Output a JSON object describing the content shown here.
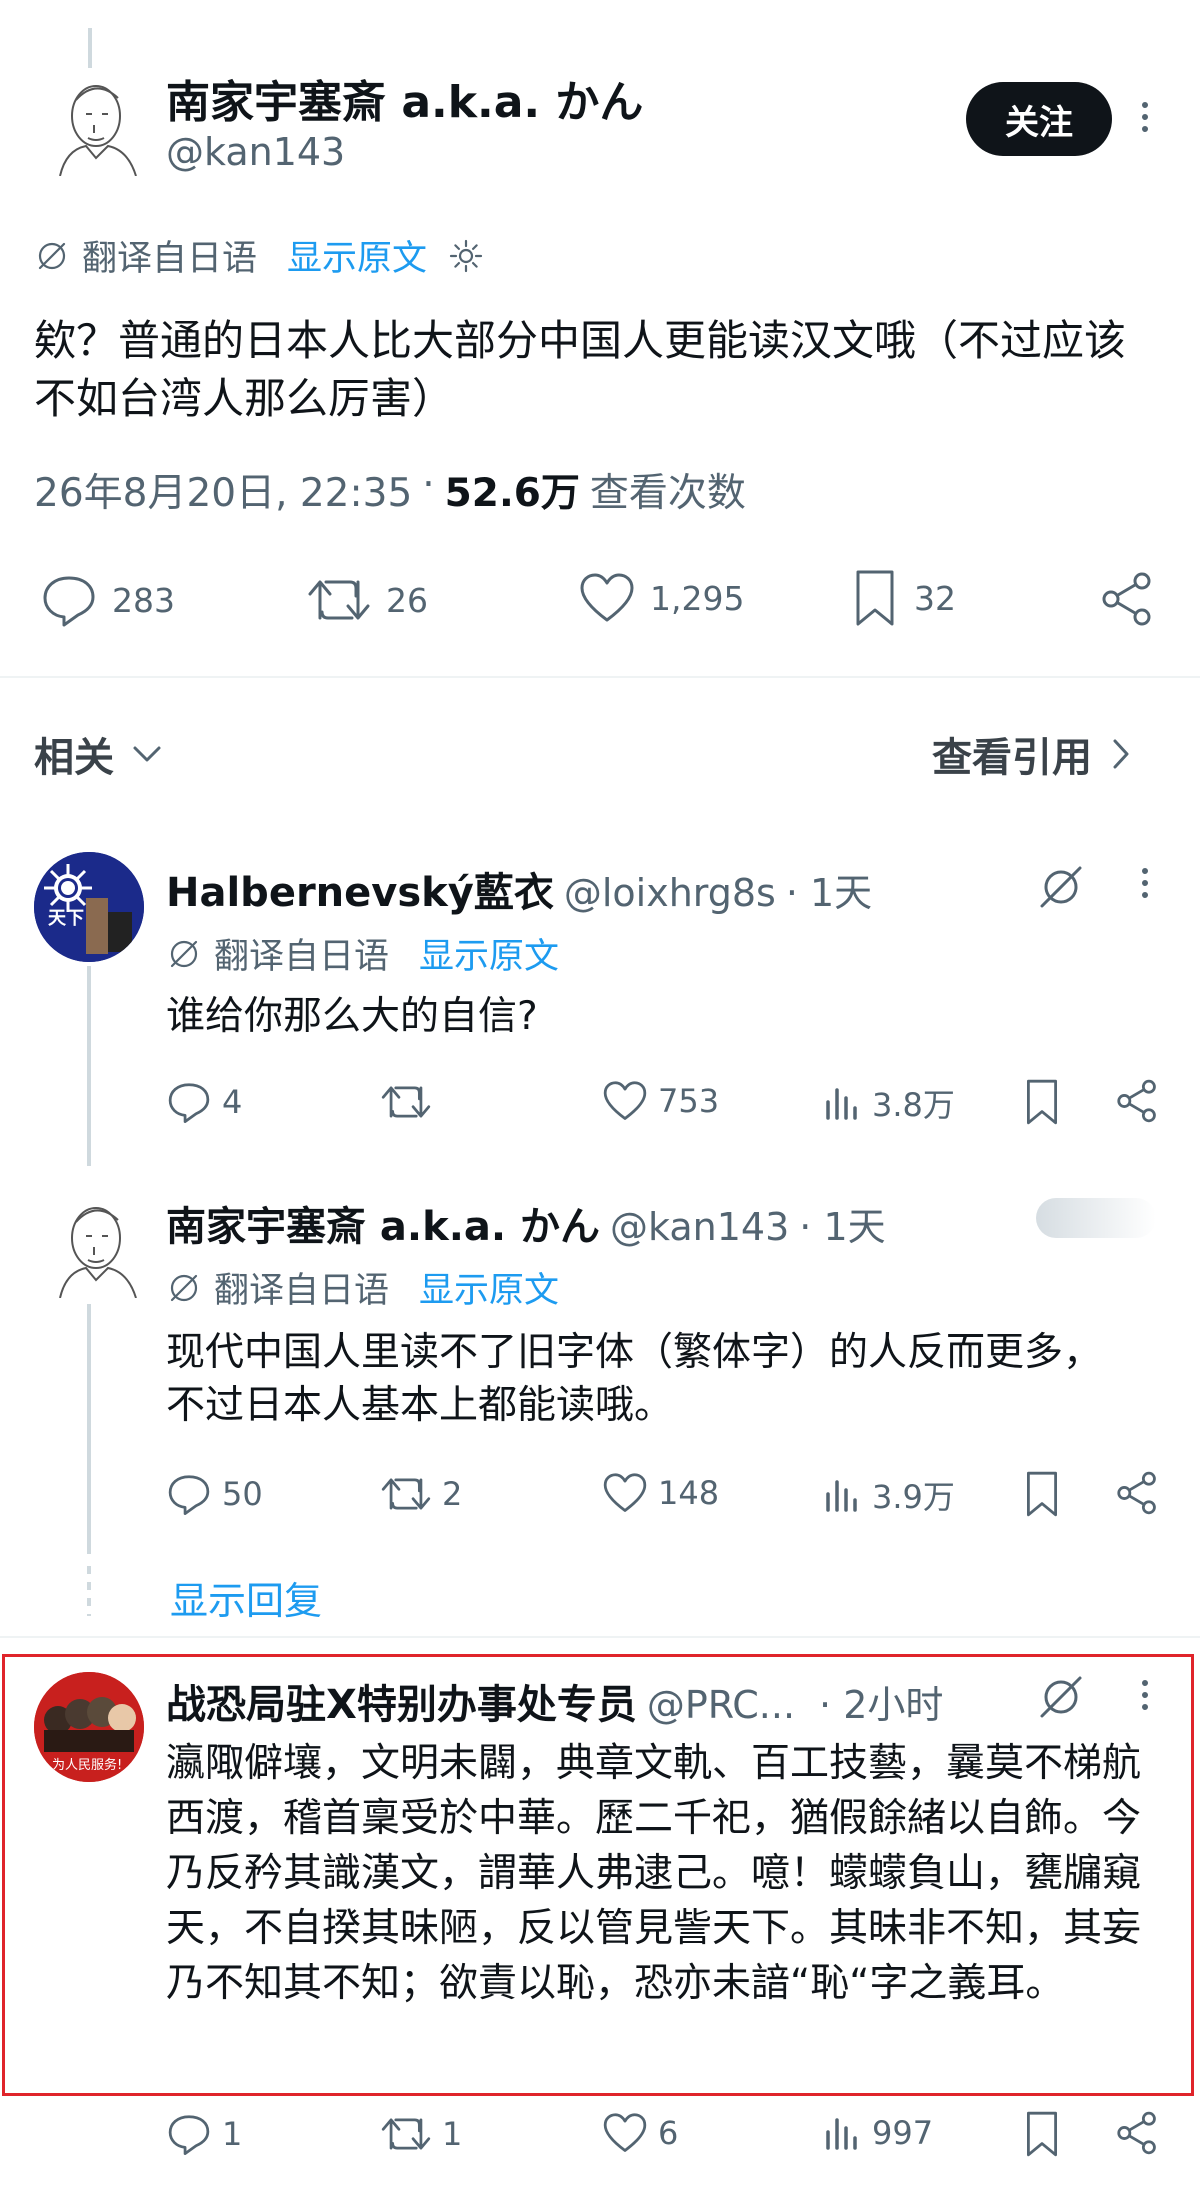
{
  "main_post": {
    "author_name": "南家宇塞斎 a.k.a. かん",
    "author_handle": "@kan143",
    "follow_label": "关注",
    "translate_label": "翻译自日语",
    "show_original_label": "显示原文",
    "text": "欸？普通的日本人比大部分中国人更能读汉文哦（不过应该不如台湾人那么厉害）",
    "timestamp": "26年8月20日, 22:35",
    "separator": "·",
    "views_count": "52.6万",
    "views_label": "查看次数",
    "replies": "283",
    "reposts": "26",
    "likes": "1,295",
    "bookmarks": "32"
  },
  "related_bar": {
    "label": "相关",
    "quotes_label": "查看引用"
  },
  "replies": [
    {
      "author_name": "Halbernevský藍衣",
      "author_handle": "@loixhrg8s",
      "time": "· 1天",
      "translate_label": "翻译自日语",
      "show_original_label": "显示原文",
      "text": "谁给你那么大的自信?",
      "replies": "4",
      "reposts": "",
      "likes": "753",
      "views": "3.8万",
      "avatar_text": "天下"
    },
    {
      "author_name": "南家宇塞斎 a.k.a. かん",
      "author_handle": "@kan143",
      "time": "· 1天",
      "translate_label": "翻译自日语",
      "show_original_label": "显示原文",
      "text": "现代中国人里读不了旧字体（繁体字）的人反而更多，不过日本人基本上都能读哦。",
      "replies": "50",
      "reposts": "2",
      "likes": "148",
      "views": "3.9万"
    },
    {
      "author_name": "战恐局驻X特别办事处专员",
      "author_handle": "@PRC...",
      "time": "· 2小时",
      "text": "瀛陬僻壤，文明未闢，典章文軌、百工技藝，曩莫不梯航西渡，稽首稟受於中華。歷二千祀，猶假餘緒以自飾。今乃反矜其識漢文，謂華人弗逮己。噫！蠓蠓負山，甕牖窺天，不自揆其昧陋，反以管見訾天下。其昧非不知，其妄乃不知其不知；欲責以恥，恐亦未諳“恥“字之義耳。",
      "replies": "1",
      "reposts": "1",
      "likes": "6",
      "views": "997",
      "avatar_text": "为人民服务!"
    }
  ],
  "show_replies_label": "显示回复",
  "colors": {
    "accent": "#1d9bf0",
    "text": "#0f1419",
    "secondary": "#536471",
    "highlight_border": "#e0242a"
  }
}
